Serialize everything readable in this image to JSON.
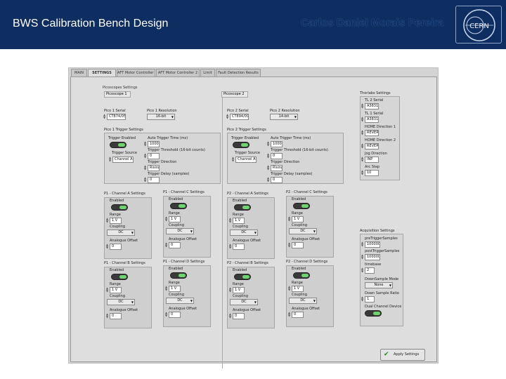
{
  "header": {
    "title": "BWS Calibration Bench Design",
    "author": "Carlos Daniel Morais Pereira",
    "logo_text": "CERN"
  },
  "tabs": [
    "MAIN",
    "SETTINGS",
    "AFT Motor Controller 1",
    "AFT Motor Controller 2",
    "Limit",
    "Fault Detection Results"
  ],
  "picoscope": {
    "section_label": "Picoscopes Settings",
    "scopes": [
      {
        "tab": "Picoscope 1",
        "serial_label": "Pico 1 Serial",
        "serial": "CT874/058",
        "res_label": "Pico 1 Resolution",
        "resolution": "16-bit",
        "trig_section": "Pico 1 Trigger Settings"
      },
      {
        "tab": "Picoscope 2",
        "serial_label": "Pico 2 Serial",
        "serial": "CT894/095",
        "res_label": "Pico 2 Resolution",
        "resolution": "14-bit",
        "trig_section": "Pico 2 Trigger Settings"
      }
    ],
    "trigger": {
      "enabled_label": "Trigger Enabled",
      "auto_time_label": "Auto Trigger Time (ms)",
      "auto_time": "1000",
      "threshold_label": "Trigger Threshold (16-bit counts)",
      "threshold": "0",
      "source_label": "Trigger Source",
      "source": "Channel A",
      "direction_label": "Trigger Direction",
      "direction": "Rising",
      "delay_label": "Trigger Delay (samples)",
      "delay": "0"
    },
    "channels": {
      "enabled_label": "Enabled",
      "range_label": "Range",
      "range": "1 V",
      "coupling_label": "Coupling",
      "coupling": "DC",
      "offset_label": "Analogue Offset",
      "offset": "0"
    },
    "channel_titles": [
      "P1 - Channel A Settings",
      "P1 - Channel C Settings",
      "P1 - Channel B Settings",
      "P1 - Channel D Settings",
      "P2 - Channel A Settings",
      "P2 - Channel C Settings",
      "P2 - Channel B Settings",
      "P2 - Channel D Settings"
    ]
  },
  "thorlabs": {
    "title": "Thorlabs Settings",
    "items": [
      {
        "label": "TL 2 Serial",
        "value": "A383117"
      },
      {
        "label": "TL 1 Serial",
        "value": "A383100"
      },
      {
        "label": "HOME Direction 1",
        "value": "REVER"
      },
      {
        "label": "HOME Direction 2",
        "value": "REVER"
      },
      {
        "label": "Jog Direction",
        "value": "INP"
      },
      {
        "label": "Arc Step",
        "value": "10"
      }
    ]
  },
  "acquisition": {
    "title": "Acquisition Settings",
    "pre_label": "preTriggerSamples",
    "pre": "1000000",
    "post_label": "postTriggerSamples",
    "post": "1000000",
    "timebase_label": "timebase",
    "timebase": "2",
    "downsample_label": "DownSample Mode",
    "downsample": "None",
    "ratio_label": "Down Sample Ratio",
    "ratio": "1",
    "dual_label": "Dual Channel Device"
  },
  "apply_label": "Apply Settings"
}
